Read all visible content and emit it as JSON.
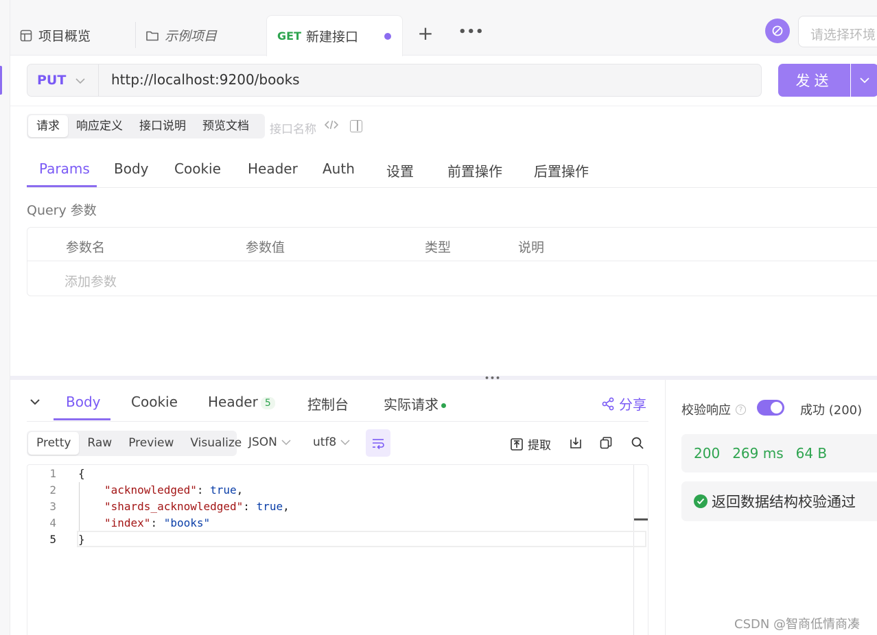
{
  "tabs": {
    "overview": "项目概览",
    "example": "示例项目",
    "active_method": "GET",
    "active_label": "新建接口",
    "plus": "+",
    "more": "•••"
  },
  "env": {
    "placeholder": "请选择环境"
  },
  "request": {
    "method": "PUT",
    "url": "http://localhost:9200/books",
    "send": "发送"
  },
  "subtabs": [
    "请求",
    "响应定义",
    "接口说明",
    "预览文档"
  ],
  "api_name_placeholder": "接口名称",
  "param_tabs": [
    "Params",
    "Body",
    "Cookie",
    "Header",
    "Auth",
    "设置",
    "前置操作",
    "后置操作"
  ],
  "query": {
    "label": "Query 参数",
    "headers": [
      "参数名",
      "参数值",
      "类型",
      "说明"
    ],
    "add": "添加参数"
  },
  "response": {
    "tabs": {
      "body": "Body",
      "cookie": "Cookie",
      "header": "Header",
      "header_count": "5",
      "console": "控制台",
      "actual": "实际请求"
    },
    "share": "分享",
    "view_modes": [
      "Pretty",
      "Raw",
      "Preview",
      "Visualize"
    ],
    "format": "JSON",
    "encoding": "utf8",
    "extract": "提取",
    "code_lines": [
      {
        "n": "1",
        "text": "{"
      },
      {
        "n": "2",
        "key": "\"acknowledged\"",
        "sep": ": ",
        "val": "true",
        "end": ","
      },
      {
        "n": "3",
        "key": "\"shards_acknowledged\"",
        "sep": ": ",
        "val": "true",
        "end": ","
      },
      {
        "n": "4",
        "key": "\"index\"",
        "sep": ": ",
        "val": "\"books\"",
        "end": ""
      },
      {
        "n": "5",
        "text": "}"
      }
    ]
  },
  "verify": {
    "label": "校验响应",
    "help": "?",
    "toggle_on": true,
    "result": "成功 (200)",
    "status": "200",
    "time": "269 ms",
    "size": "64 B",
    "message": "返回数据结构校验通过"
  },
  "watermark": "CSDN @智商低情商凑",
  "colors": {
    "accent": "#8b6cf0",
    "success": "#2ea44f"
  }
}
